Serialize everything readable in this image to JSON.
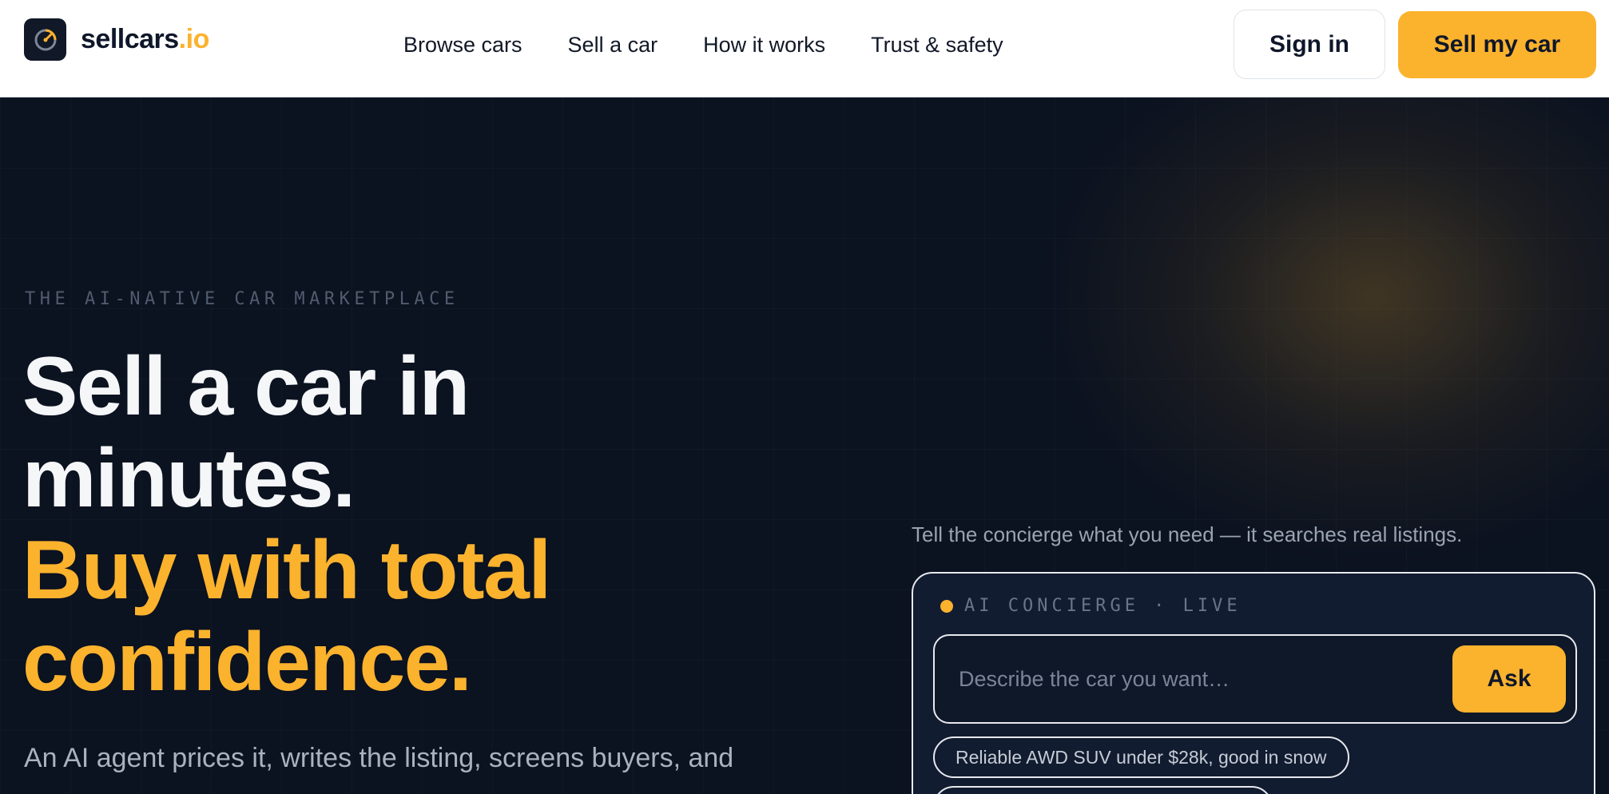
{
  "brand": {
    "name_main": "sellcars",
    "name_accent": ".io",
    "logo_icon": "speedometer-icon",
    "accent_color": "#fbb22d"
  },
  "nav": {
    "items": [
      {
        "label": "Browse cars"
      },
      {
        "label": "Sell a car"
      },
      {
        "label": "How it works"
      },
      {
        "label": "Trust & safety"
      }
    ]
  },
  "header_actions": {
    "signin_label": "Sign in",
    "sell_label": "Sell my car"
  },
  "hero": {
    "eyebrow": "THE AI-NATIVE CAR MARKETPLACE",
    "headline_line1": "Sell a car in",
    "headline_line2": "minutes.",
    "headline_line3": "Buy with total",
    "headline_line4": "confidence.",
    "subcopy": "An AI agent prices it, writes the listing, screens buyers, and"
  },
  "concierge": {
    "hint": "Tell the concierge what you need — it searches real listings.",
    "status_label": "AI CONCIERGE · LIVE",
    "input_placeholder": "Describe the car you want…",
    "ask_label": "Ask",
    "suggestions": [
      {
        "label": "Reliable AWD SUV under $28k, good in snow"
      }
    ]
  }
}
